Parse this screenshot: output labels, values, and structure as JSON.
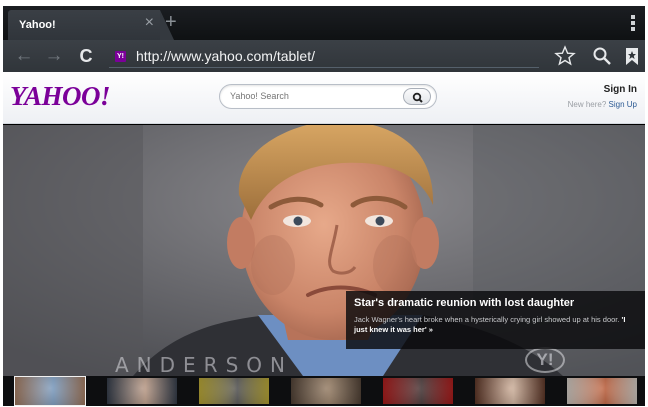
{
  "browser": {
    "tab_title": "Yahoo!",
    "tab_close": "×",
    "new_tab": "+",
    "url": "http://www.yahoo.com/tablet/",
    "favicon_letter": "Y!",
    "icons": [
      "back-icon",
      "forward-icon",
      "reload-icon",
      "star-icon",
      "search-icon",
      "bookmarks-icon",
      "menu-icon"
    ]
  },
  "yahoo": {
    "logo": "YAHOO!",
    "search_placeholder": "Yahoo! Search",
    "sign_in": "Sign In",
    "new_here": "New here?",
    "sign_up": "Sign Up",
    "brand_color": "#7b0099"
  },
  "hero": {
    "watermark": "ANDERSON",
    "bug": "Y!",
    "headline": "Star's dramatic reunion with lost daughter",
    "body": "Jack Wagner's heart broke when a hysterically crying girl showed up at his door.",
    "link": "'I just knew it was her' »"
  },
  "filmstrip": {
    "active_index": 0,
    "thumbnails": [
      {
        "name": "thumb-star-reunion",
        "colors": [
          "#c09070",
          "#6a8fb8"
        ]
      },
      {
        "name": "thumb-politicians",
        "colors": [
          "#3a4454",
          "#b38f78"
        ]
      },
      {
        "name": "thumb-portrait",
        "colors": [
          "#d8c23a",
          "#3b3b3b"
        ]
      },
      {
        "name": "thumb-crowd",
        "colors": [
          "#5c4a3c",
          "#8a6e52"
        ]
      },
      {
        "name": "thumb-red-stage",
        "colors": [
          "#c81c1c",
          "#2b1a1a"
        ]
      },
      {
        "name": "thumb-dining",
        "colors": [
          "#6a3c2a",
          "#c9a890"
        ]
      },
      {
        "name": "thumb-food",
        "colors": [
          "#f2ece4",
          "#b34a22"
        ]
      }
    ]
  }
}
